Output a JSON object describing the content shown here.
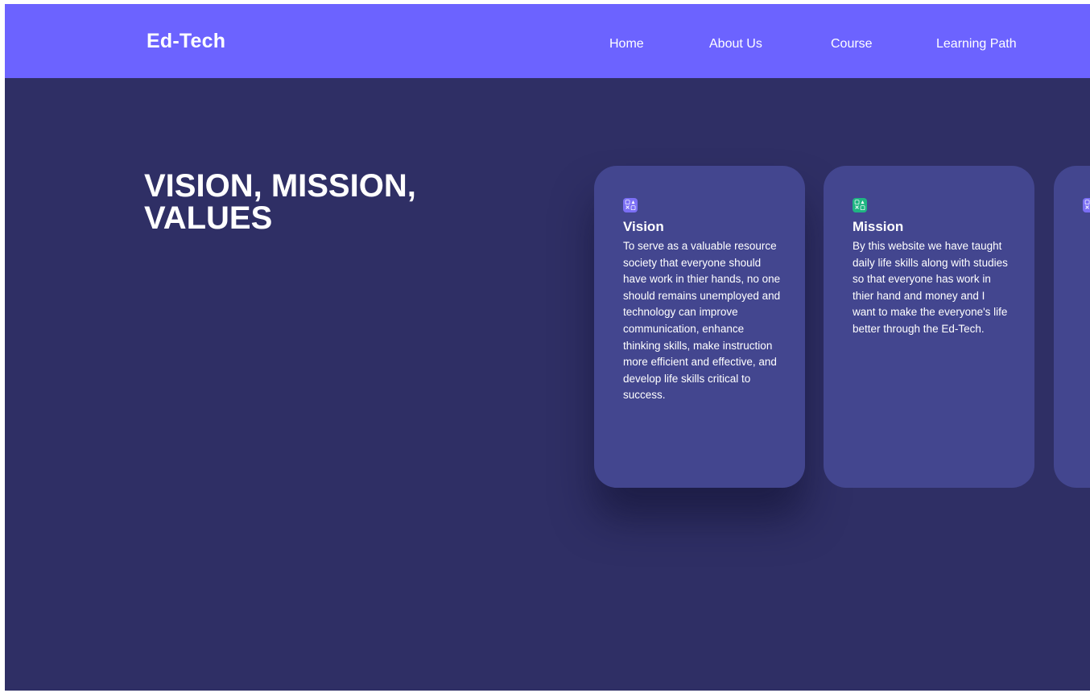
{
  "header": {
    "brand": "Ed-Tech",
    "nav": {
      "home": "Home",
      "about": "About Us",
      "course": "Course",
      "learning_path": "Learning Path"
    }
  },
  "hero": {
    "heading_line1": "VISION, MISSION,",
    "heading_line2": "VALUES"
  },
  "cards": [
    {
      "icon": "app-grid-icon",
      "icon_color": "#7b6ff5",
      "title": "Vision",
      "text": "To serve as a valuable resource society that everyone should have work in thier hands, no one should remains unemployed and technology can improve communication, enhance thinking skills, make instruction more efficient and effective, and develop life skills critical to success."
    },
    {
      "icon": "app-grid-icon",
      "icon_color": "#1fb582",
      "title": "Mission",
      "text": "By this website we have taught daily life skills along with studies so that everyone has work in thier hand and money and I want to make the everyone's life better through the Ed-Tech."
    }
  ],
  "colors": {
    "navbar": "#6c63ff",
    "background": "#2f2f65",
    "card": "#43468f"
  }
}
